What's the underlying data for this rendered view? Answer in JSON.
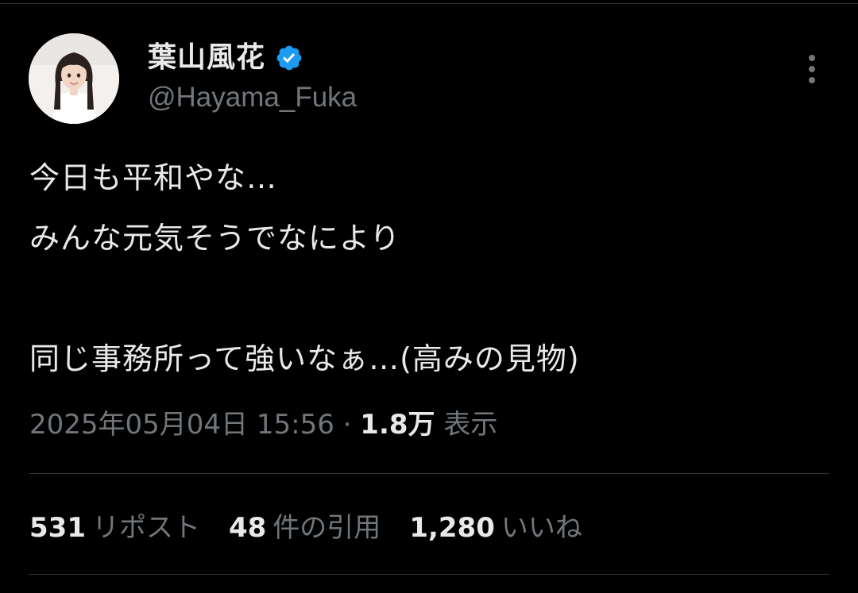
{
  "user": {
    "display_name": "葉山風花",
    "handle": "@Hayama_Fuka",
    "verified": true
  },
  "icons": {
    "verified": "verified-badge-icon",
    "more": "more-vertical-icon"
  },
  "tweet": {
    "text": "今日も平和やな…\nみんな元気そうでなにより\n\n同じ事務所って強いなぁ…(高みの見物)"
  },
  "meta": {
    "timestamp": "2025年05月04日 15:56",
    "separator": "·",
    "views_count": "1.8万",
    "views_label": "表示"
  },
  "stats": {
    "retweets": {
      "count": "531",
      "label": "リポスト"
    },
    "quotes": {
      "count": "48",
      "label": "件の引用"
    },
    "likes": {
      "count": "1,280",
      "label": "いいね"
    }
  },
  "colors": {
    "background": "#000000",
    "primary_text": "#e7e9ea",
    "secondary_text": "#71767b",
    "verified_blue": "#1d9bf0",
    "divider": "#2f3336"
  }
}
